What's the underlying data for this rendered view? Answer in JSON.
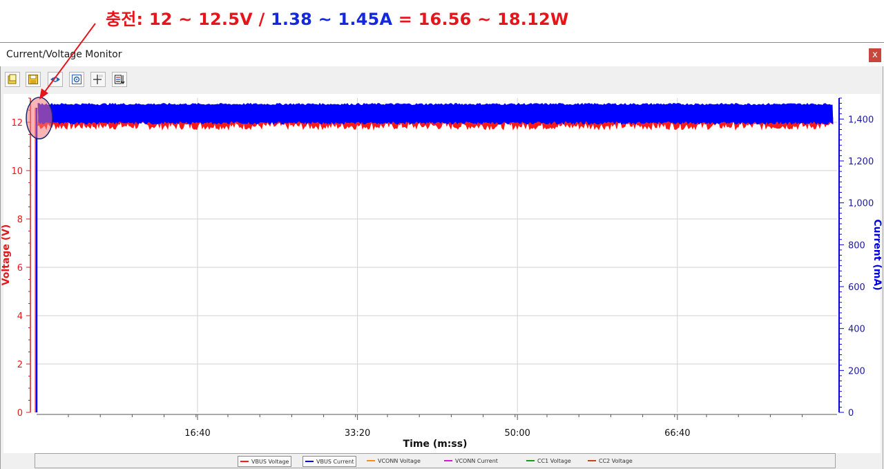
{
  "annotation": {
    "prefix": "충전: 12 ~ 12.5V / ",
    "current": "1.38 ~ 1.45A",
    "suffix": " = 16.56 ~ 18.12W",
    "colors": {
      "red": "#e8141c",
      "blue": "#1428e0"
    }
  },
  "window": {
    "title": "Current/Voltage Monitor",
    "close_label": "x"
  },
  "toolbar": {
    "buttons": [
      {
        "name": "open-icon"
      },
      {
        "name": "save-icon"
      },
      {
        "name": "zoom-fit-icon"
      },
      {
        "name": "zoom-center-icon"
      },
      {
        "name": "cursor-value-icon"
      },
      {
        "name": "settings-icon"
      }
    ]
  },
  "chart_data": {
    "type": "line",
    "xlabel": "Time (m:ss)",
    "ylabel_left": "Voltage (V)",
    "ylabel_right": "Current (mA)",
    "x_ticks": [
      "16:40",
      "33:20",
      "50:00",
      "66:40"
    ],
    "y_left_ticks": [
      "0",
      "2",
      "4",
      "6",
      "8",
      "10",
      "12"
    ],
    "y_right_ticks": [
      "0",
      "200",
      "400",
      "600",
      "800",
      "1,000",
      "1,200",
      "1,400"
    ],
    "ylim_left": [
      0,
      13
    ],
    "ylim_right": [
      0,
      1500
    ],
    "grid": true,
    "series": [
      {
        "name": "VBUS Voltage",
        "axis": "left",
        "color": "#ff1a1a",
        "band": [
          11.7,
          12.3
        ]
      },
      {
        "name": "VBUS Current",
        "axis": "right",
        "color": "#0000ff",
        "band": [
          1380,
          1450
        ]
      }
    ],
    "legend": [
      {
        "label": "VBUS Voltage",
        "color": "#ff1a1a"
      },
      {
        "label": "VBUS Current",
        "color": "#0000ff"
      },
      {
        "label": "VCONN Voltage",
        "color": "#ff8c1a"
      },
      {
        "label": "VCONN Current",
        "color": "#d21ad2"
      },
      {
        "label": "CC1 Voltage",
        "color": "#1a9a1a"
      },
      {
        "label": "CC2 Voltage",
        "color": "#c0461a"
      }
    ]
  }
}
